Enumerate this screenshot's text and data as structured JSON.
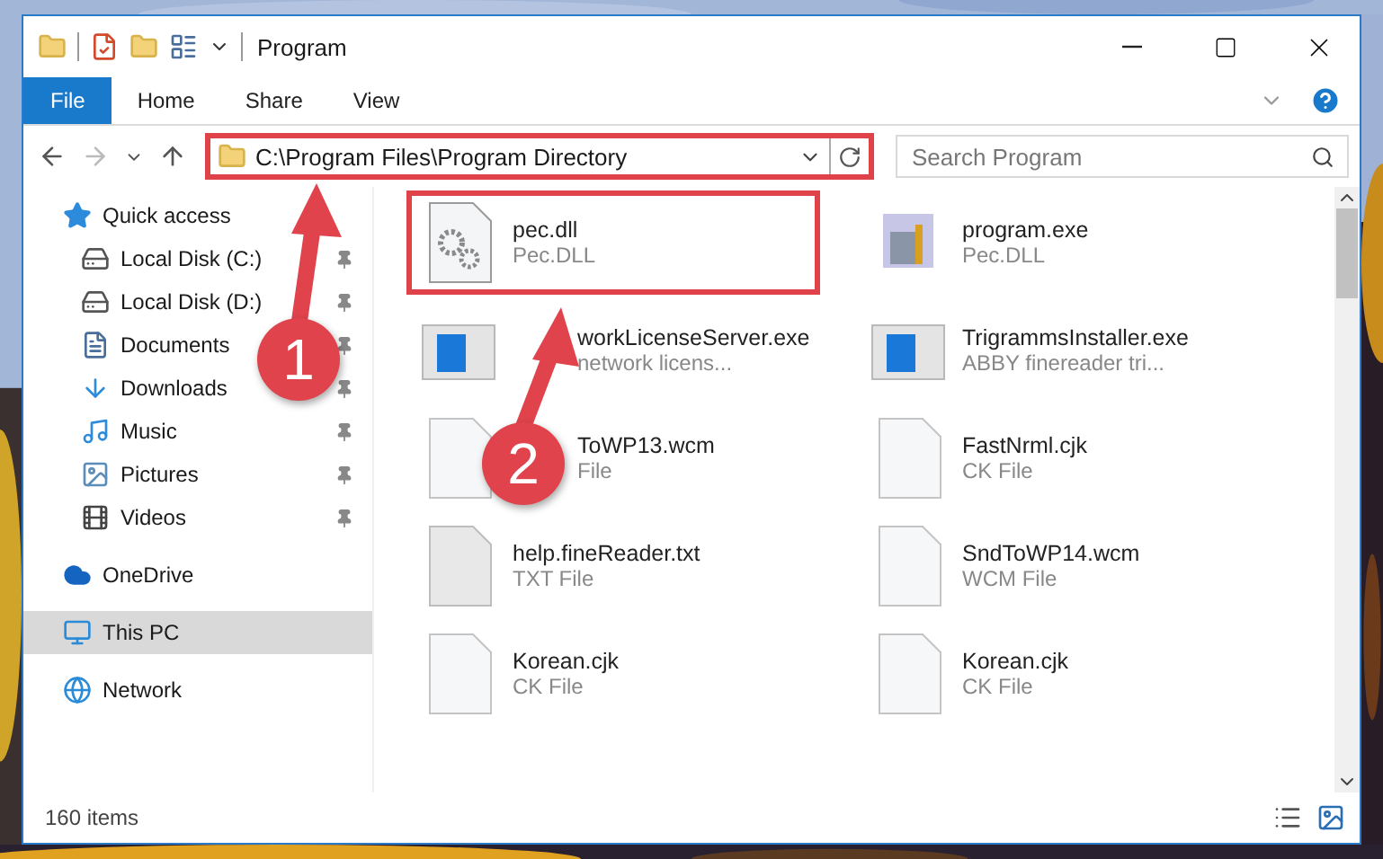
{
  "window": {
    "title": "Program"
  },
  "ribbon_tabs": [
    {
      "label": "File",
      "kind": "file"
    },
    {
      "label": "Home",
      "kind": "tab"
    },
    {
      "label": "Share",
      "kind": "tab"
    },
    {
      "label": "View",
      "kind": "tab"
    }
  ],
  "address": {
    "path": "C:\\Program Files\\Program Directory",
    "highlighted": true
  },
  "search": {
    "placeholder": "Search Program"
  },
  "sidebar": {
    "items": [
      {
        "label": "Quick access",
        "selected": false,
        "children": [
          {
            "label": "Local Disk (C:)",
            "pinned": true
          },
          {
            "label": "Local Disk (D:)",
            "pinned": true
          },
          {
            "label": "Documents",
            "pinned": true
          },
          {
            "label": "Downloads",
            "pinned": true
          },
          {
            "label": "Music",
            "pinned": true
          },
          {
            "label": "Pictures",
            "pinned": true
          },
          {
            "label": "Videos",
            "pinned": true
          }
        ]
      },
      {
        "label": "OneDrive",
        "selected": false
      },
      {
        "label": "This PC",
        "selected": true
      },
      {
        "label": "Network",
        "selected": false
      }
    ]
  },
  "files": [
    {
      "name": "pec.dll",
      "type": "Pec.DLL",
      "kind": "gears",
      "highlighted": true,
      "covered": false
    },
    {
      "name": "program.exe",
      "type": "Pec.DLL",
      "kind": "installer",
      "highlighted": false,
      "covered": false
    },
    {
      "name": "workLicenseServer.exe",
      "type": "network licens...",
      "kind": "window",
      "highlighted": false,
      "covered": true
    },
    {
      "name": "TrigrammsInstaller.exe",
      "type": "ABBY finereader tri...",
      "kind": "window",
      "highlighted": false,
      "covered": false
    },
    {
      "name": "ToWP13.wcm",
      "type": "File",
      "kind": "blank",
      "highlighted": false,
      "covered": true
    },
    {
      "name": "FastNrml.cjk",
      "type": "CK File",
      "kind": "blank",
      "highlighted": false,
      "covered": false
    },
    {
      "name": "help.fineReader.txt",
      "type": "TXT File",
      "kind": "text",
      "highlighted": false,
      "covered": false
    },
    {
      "name": "SndToWP14.wcm",
      "type": "WCM File",
      "kind": "blank",
      "highlighted": false,
      "covered": false
    },
    {
      "name": "Korean.cjk",
      "type": "CK File",
      "kind": "blank",
      "highlighted": false,
      "covered": false
    },
    {
      "name": "Korean.cjk",
      "type": "CK File",
      "kind": "blank",
      "highlighted": false,
      "covered": false
    }
  ],
  "status_bar": {
    "count": "160 items"
  },
  "annotations": [
    {
      "number": "1"
    },
    {
      "number": "2"
    }
  ]
}
